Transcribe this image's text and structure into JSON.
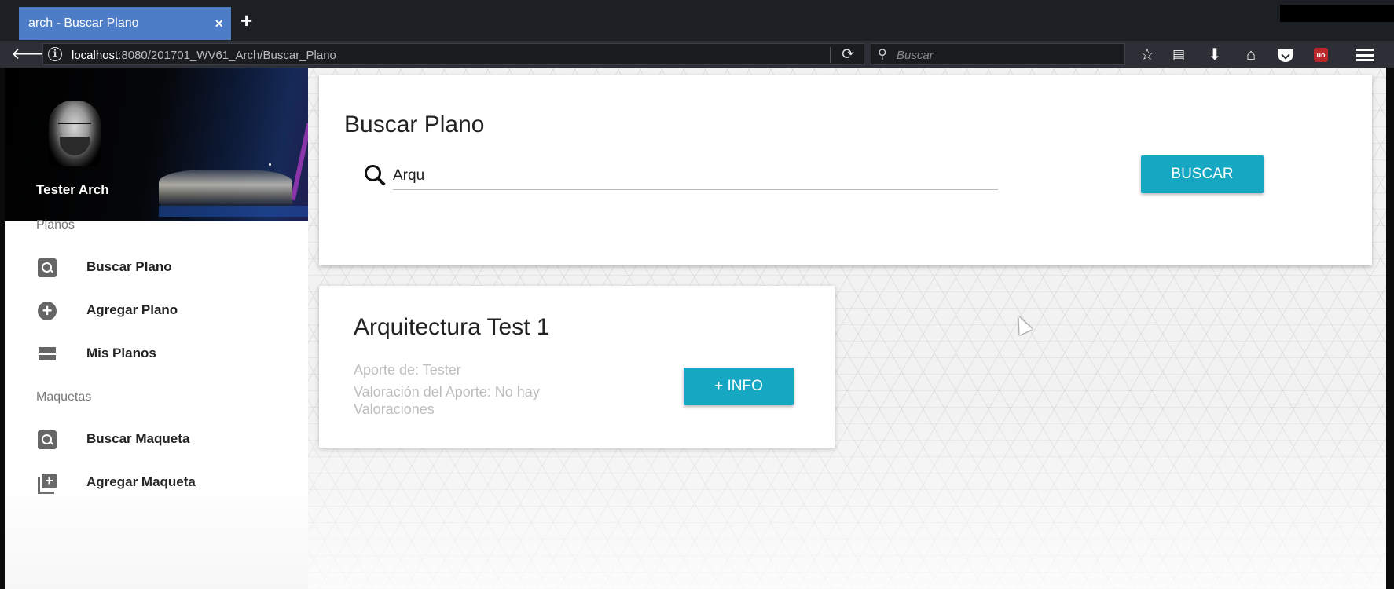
{
  "browser": {
    "tab_title": "arch - Buscar Plano",
    "tab_close": "×",
    "new_tab": "+",
    "url_host": "localhost",
    "url_rest": ":8080/201701_WV61_Arch/Buscar_Plano",
    "search_placeholder": "Buscar",
    "info_glyph": "i",
    "reload_glyph": "⟳",
    "back_glyph": "🡐",
    "icons": [
      "star-icon",
      "reader-icon",
      "download-icon",
      "home-icon",
      "pocket-icon",
      "ublock-icon",
      "menu-icon"
    ],
    "ublock_text": "uo"
  },
  "sidebar": {
    "username": "Tester Arch",
    "sections": [
      {
        "title": "Planos",
        "items": [
          {
            "label": "Buscar Plano",
            "icon": "search-doc-icon"
          },
          {
            "label": "Agregar Plano",
            "icon": "add-circle-icon"
          },
          {
            "label": "Mis Planos",
            "icon": "list-icon"
          }
        ]
      },
      {
        "title": "Maquetas",
        "items": [
          {
            "label": "Buscar Maqueta",
            "icon": "search-doc-icon"
          },
          {
            "label": "Agregar Maqueta",
            "icon": "add-box-icon"
          }
        ]
      }
    ]
  },
  "search": {
    "title": "Buscar Plano",
    "query": "Arqu",
    "button": "BUSCAR"
  },
  "results": [
    {
      "title": "Arquitectura Test 1",
      "aporte": "Aporte de: Tester",
      "valoracion": "Valoración del Aporte: No hay Valoraciones",
      "button": "+ INFO"
    }
  ],
  "colors": {
    "accent": "#16a8c3",
    "tab_active": "#4e7dc7",
    "chrome_dark": "#1c1f24"
  }
}
